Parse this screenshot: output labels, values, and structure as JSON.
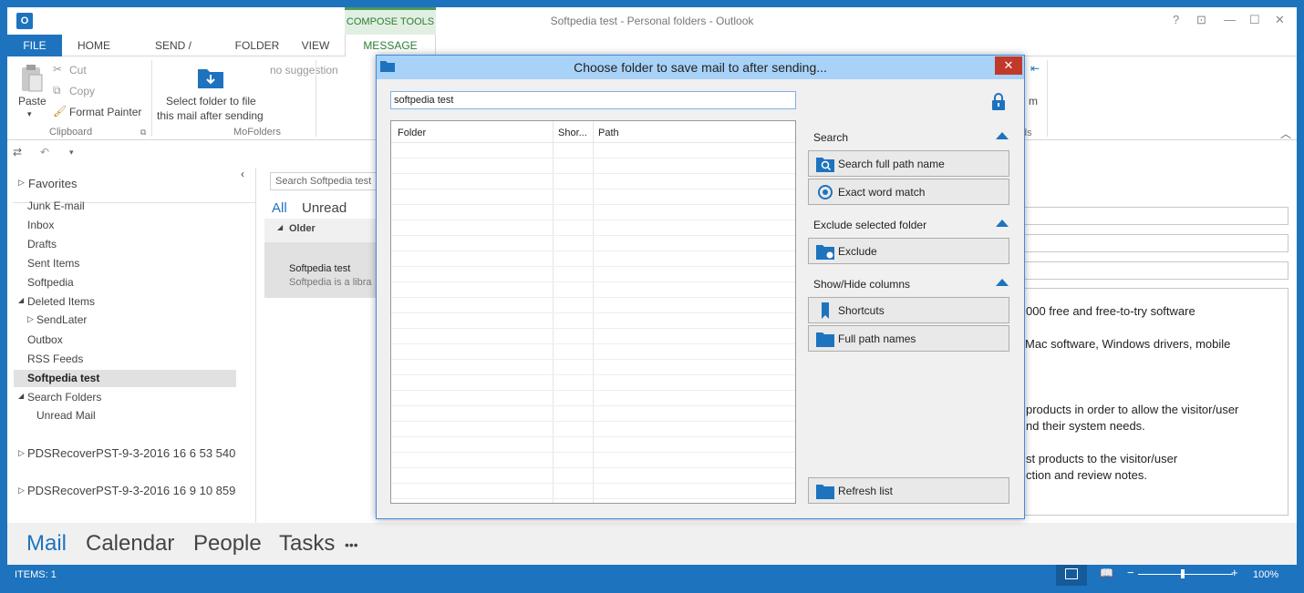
{
  "window": {
    "title": "Softpedia test - Personal folders - Outlook",
    "context_tab": "COMPOSE TOOLS",
    "app_icon": "O"
  },
  "tabs": [
    "FILE",
    "HOME",
    "SEND / RECEIVE",
    "FOLDER",
    "VIEW",
    "MESSAGE"
  ],
  "ribbon": {
    "paste": "Paste",
    "cut": "Cut",
    "copy": "Copy",
    "format_painter": "Format Painter",
    "clipboard_group": "Clipboard",
    "select_folder_line1": "Select folder to file",
    "select_folder_line2": "this mail after sending",
    "mofolders_group": "MoFolders",
    "no_suggestion": "no suggestion",
    "right_fragment_m": "m",
    "right_fragment_ds": "ds"
  },
  "folders": {
    "favorites": "Favorites",
    "items": [
      "Junk E-mail",
      "Inbox",
      "Drafts",
      "Sent Items",
      "Softpedia",
      "Deleted Items",
      "SendLater",
      "Outbox",
      "RSS Feeds",
      "Softpedia test",
      "Search Folders",
      "Unread Mail"
    ],
    "pst1": "PDSRecoverPST-9-3-2016 16 6 53 540",
    "pst2": "PDSRecoverPST-9-3-2016 16 9 10 859"
  },
  "mail_list": {
    "search_placeholder": "Search Softpedia test",
    "filter_all": "All",
    "filter_unread": "Unread",
    "group": "Older",
    "item_sender": "Softpedia test",
    "item_preview": "Softpedia is a libra"
  },
  "reading": {
    "lines": [
      "000 free and free-to-try software",
      "Mac software, Windows drivers, mobile",
      "products in order to allow the visitor/user",
      "nd their system needs.",
      "st products to the visitor/user",
      "ction and review notes."
    ]
  },
  "bottom_nav": [
    "Mail",
    "Calendar",
    "People",
    "Tasks",
    "•••"
  ],
  "status": {
    "items": "ITEMS: 1",
    "zoom": "100%"
  },
  "dialog": {
    "title": "Choose folder to save mail to after sending...",
    "close": "✕",
    "search_value": "softpedia test",
    "columns": [
      "Folder",
      "Shor...",
      "Path"
    ],
    "search_section": "Search",
    "btn_search_full": "Search full path name",
    "btn_exact": "Exact word match",
    "exclude_section": "Exclude selected folder",
    "btn_exclude": "Exclude",
    "columns_section": "Show/Hide columns",
    "btn_shortcuts": "Shortcuts",
    "btn_full_path": "Full path names",
    "btn_refresh": "Refresh list"
  },
  "colors": {
    "accent": "#1e73be",
    "dialog_title": "#a8d2f8",
    "close": "#c0392b",
    "context": "#2e7d32"
  }
}
